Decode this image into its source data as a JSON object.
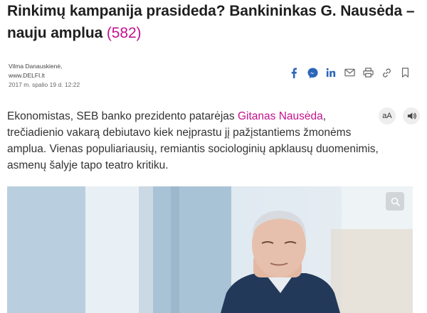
{
  "article": {
    "title": "Rinkimų kampanija prasideda? Bankininkas G. Nausėda – nauju amplua",
    "comment_count": "(582)",
    "author": "Vilma Danauskienė,",
    "source": "www.DELFI.lt",
    "date": "2017 m. spalio 19 d. 12:22",
    "lead_before": "Ekonomistas, SEB banko prezidento patarėjas ",
    "lead_link": "Gitanas Nausėda",
    "lead_after": ", trečiadienio vakarą debiutavo kiek neįprastu jį pažįstantiems žmonėms amplua. Vienas populiariausių, remiantis sociologinių apklausų duomenimis, asmenų šalyje tapo teatro kritiku."
  },
  "tools": {
    "font_size_label": "aA"
  },
  "colors": {
    "accent": "#c3128d",
    "share_blue": "#2b66b8"
  },
  "share_icons": [
    "facebook-icon",
    "messenger-icon",
    "linkedin-icon",
    "email-icon",
    "print-icon",
    "link-icon",
    "bookmark-icon"
  ]
}
